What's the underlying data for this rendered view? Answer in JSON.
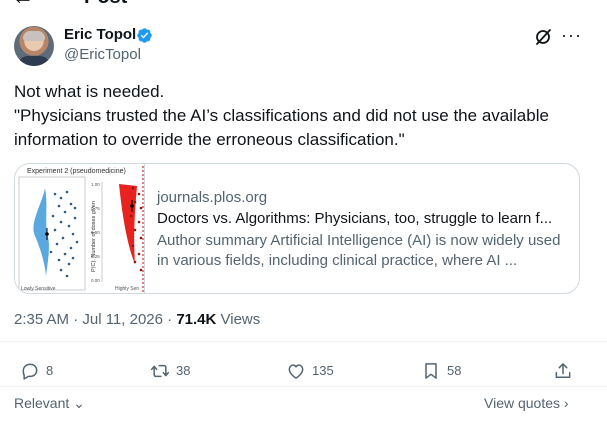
{
  "header": {
    "title": "Post",
    "back_icon": "arrow-left-icon"
  },
  "author": {
    "name": "Eric Topol",
    "handle": "@EricTopol",
    "verified": true,
    "verified_color": "#1d9bf0"
  },
  "tweet": {
    "line1": "Not what is needed.",
    "line2": "\"Physicians trusted the AI’s classifications and did not use the available information to override the erroneous classification.\""
  },
  "link_card": {
    "domain": "journals.plos.org",
    "title": "Doctors vs. Algorithms: Physicians, too, struggle to learn f...",
    "description": "Author summary Artificial Intelligence (AI) is now widely used in various fields, including clinical practice, where AI ...",
    "thumbnail": {
      "heading": "Experiment 2 (pseudomedicine)",
      "y_axis_label": "P(C): Number of doses given",
      "y_ticks": [
        "1.00",
        "0.75",
        "0.50",
        "0.25",
        "0.00"
      ],
      "x_left_label": "Lowly Sensitive",
      "x_right_label": "Highly Sen"
    }
  },
  "meta": {
    "timestamp": "2:35 AM · Jul 11, 2026 · ",
    "views_count": "71.4K",
    "views_label": " Views"
  },
  "actions": {
    "replies": "8",
    "reposts": "38",
    "likes": "135",
    "bookmarks": "58"
  },
  "footer": {
    "sort_label": "Relevant",
    "quotes_label": "View quotes"
  },
  "colors": {
    "text_primary": "#0f1419",
    "text_secondary": "#536471",
    "border": "#cfd9de",
    "accent": "#1d9bf0"
  }
}
